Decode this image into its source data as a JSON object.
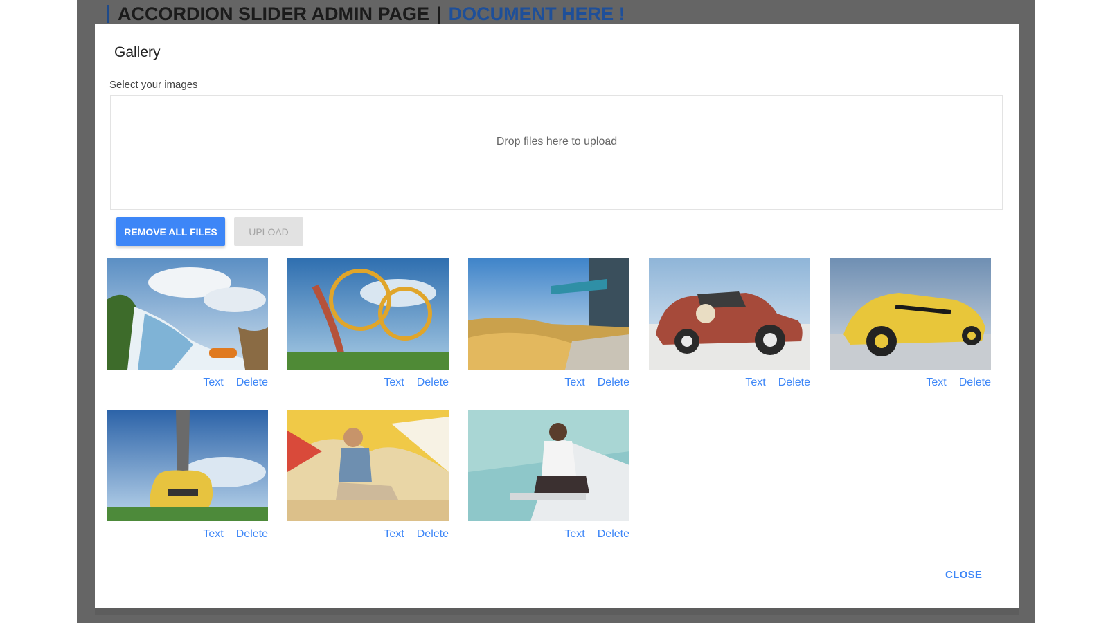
{
  "page": {
    "heading": "ACCORDION SLIDER ADMIN PAGE",
    "separator": "|",
    "doc_link": "DOCUMENT HERE !"
  },
  "modal": {
    "title": "Gallery",
    "select_label": "Select your images",
    "dropzone_text": "Drop files here to upload",
    "remove_all_label": "REMOVE ALL FILES",
    "upload_label": "UPLOAD",
    "close_label": "CLOSE"
  },
  "gallery": [
    {
      "subject": "water-ride",
      "text_label": "Text",
      "delete_label": "Delete"
    },
    {
      "subject": "roller-coaster",
      "text_label": "Text",
      "delete_label": "Delete"
    },
    {
      "subject": "dune-grass",
      "text_label": "Text",
      "delete_label": "Delete"
    },
    {
      "subject": "red-hot-rod-55",
      "text_label": "Text",
      "delete_label": "Delete"
    },
    {
      "subject": "yellow-hot-rod",
      "text_label": "Text",
      "delete_label": "Delete"
    },
    {
      "subject": "electric-guitar",
      "text_label": "Text",
      "delete_label": "Delete"
    },
    {
      "subject": "man-on-beach",
      "text_label": "Text",
      "delete_label": "Delete"
    },
    {
      "subject": "man-by-pool",
      "text_label": "Text",
      "delete_label": "Delete"
    }
  ],
  "colors": {
    "accent": "#3d86f7",
    "overlay": "#656565",
    "link_heading": "#1e4f99"
  }
}
